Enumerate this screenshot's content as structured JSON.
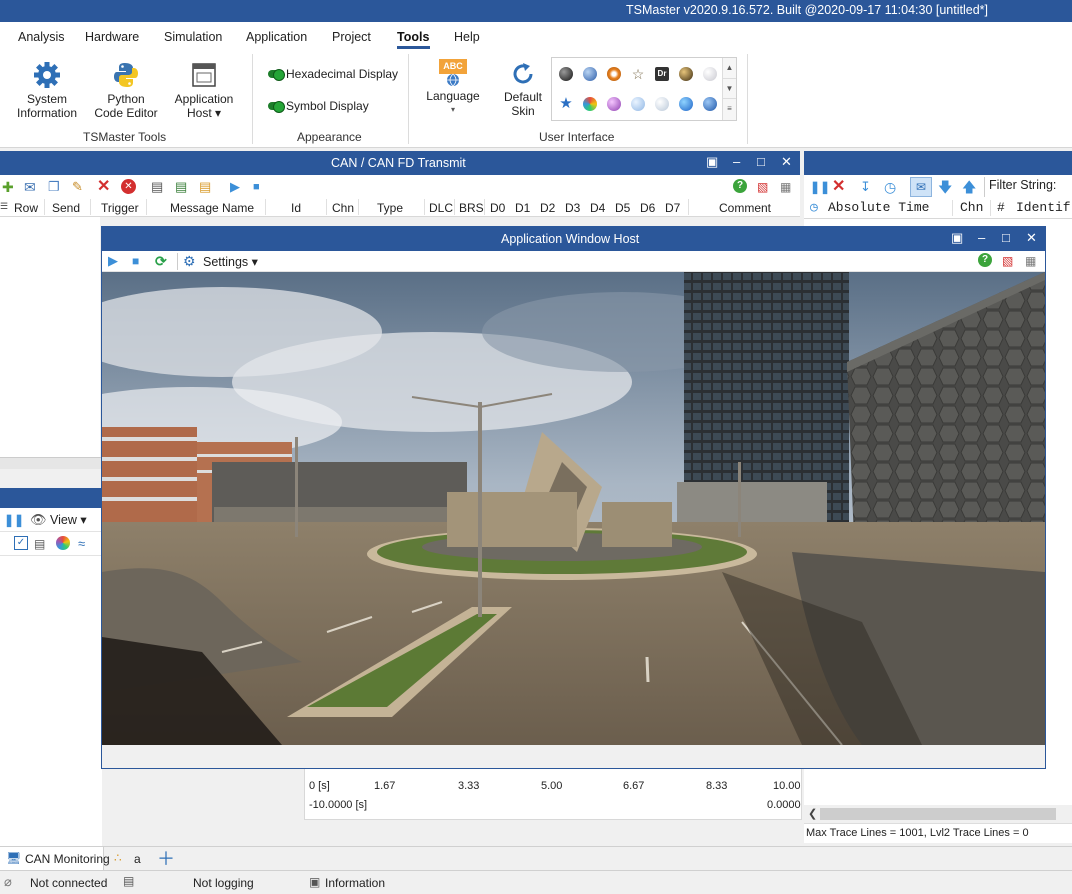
{
  "window": {
    "title": "TSMaster v2020.9.16.572. Built @2020-09-17 11:04:30 [untitled*]"
  },
  "menu": {
    "items": [
      "Analysis",
      "Hardware",
      "Simulation",
      "Application",
      "Project",
      "Tools",
      "Help"
    ],
    "active": "Tools"
  },
  "ribbon": {
    "tsmaster_tools": {
      "label": "TSMaster Tools",
      "system_information": [
        "System",
        "Information"
      ],
      "python_code_editor": [
        "Python",
        "Code Editor"
      ],
      "application_host": [
        "Application",
        "Host ▾"
      ]
    },
    "appearance": {
      "label": "Appearance",
      "hexadecimal_display": "Hexadecimal Display",
      "symbol_display": "Symbol Display"
    },
    "user_interface": {
      "label": "User Interface",
      "language": "Language",
      "language_badge": "ABC",
      "default_skin": [
        "Default",
        "Skin"
      ],
      "skin_dr_label": "Dr"
    }
  },
  "can_transmit": {
    "title": "CAN / CAN FD Transmit",
    "columns": [
      "Row",
      "Send",
      "Trigger",
      "Message Name",
      "Id",
      "Chn",
      "Type",
      "DLC",
      "BRS",
      "D0",
      "D1",
      "D2",
      "D3",
      "D4",
      "D5",
      "D6",
      "D7",
      "Comment"
    ]
  },
  "trace": {
    "filter_label": "Filter String:",
    "columns": [
      "Absolute Time",
      "Chn",
      "Identif"
    ],
    "footer": "Max Trace Lines = 1001, Lvl2 Trace Lines = 0"
  },
  "graphics": {
    "view_label": "View ▾",
    "x_ticks": [
      "0 [s]",
      "1.67",
      "3.33",
      "5.00",
      "6.67",
      "8.33",
      "10.00"
    ],
    "range_start": "-10.0000 [s]",
    "range_end": "0.0000"
  },
  "app_host": {
    "title": "Application Window Host",
    "settings_label": "Settings ▾"
  },
  "tabs": [
    "CAN Monitoring",
    "a"
  ],
  "status": {
    "connection": "Not connected",
    "logging": "Not logging",
    "information": "Information"
  },
  "colors": {
    "accent": "#2b579a",
    "toggle_on": "#25a537",
    "error_red": "#d32f2f",
    "ok_green": "#3ca43c"
  }
}
